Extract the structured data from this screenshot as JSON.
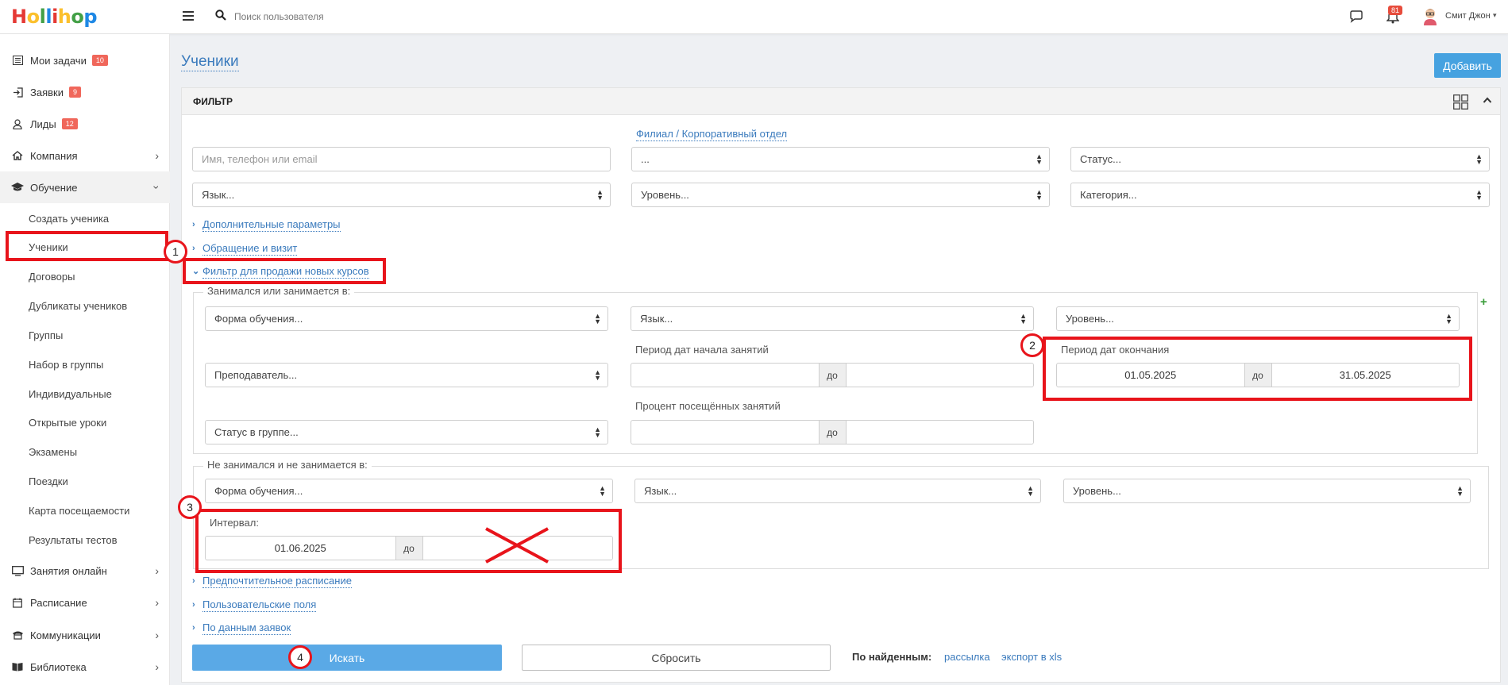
{
  "header": {
    "logo_letters": [
      "H",
      "o",
      "l",
      "l",
      "i",
      "h",
      "o",
      "p"
    ],
    "search_placeholder": "Поиск пользователя",
    "notifications_count": "81",
    "user_name": "Смит Джон"
  },
  "sidebar": {
    "items": [
      {
        "label": "Мои задачи",
        "badge": "10",
        "icon": "list-icon"
      },
      {
        "label": "Заявки",
        "badge": "9",
        "icon": "sign-in-icon"
      },
      {
        "label": "Лиды",
        "badge": "12",
        "icon": "user-icon"
      },
      {
        "label": "Компания",
        "icon": "home-icon"
      },
      {
        "label": "Обучение",
        "icon": "graduation-cap-icon"
      },
      {
        "label": "Занятия онлайн",
        "icon": "monitor-icon"
      },
      {
        "label": "Расписание",
        "icon": "calendar-icon"
      },
      {
        "label": "Коммуникации",
        "icon": "phone-icon"
      },
      {
        "label": "Библиотека",
        "icon": "book-icon"
      }
    ],
    "sub_items": [
      "Создать ученика",
      "Ученики",
      "Договоры",
      "Дубликаты учеников",
      "Группы",
      "Набор в группы",
      "Индивидуальные",
      "Открытые уроки",
      "Экзамены",
      "Поездки",
      "Карта посещаемости",
      "Результаты тестов"
    ]
  },
  "main": {
    "title": "Ученики",
    "add_button": "Добавить",
    "filter_title": "ФИЛЬТР",
    "branch_link": "Филиал / Корпоративный отдел",
    "name_placeholder": "Имя, телефон или email",
    "branch_select": "...",
    "status_select": "Статус...",
    "language_select": "Язык...",
    "level_select": "Уровень...",
    "category_select": "Категория...",
    "links": {
      "extra_params": "Дополнительные параметры",
      "appeal_visit": "Обращение и визит",
      "new_courses_filter": "Фильтр для продажи новых курсов",
      "preferred_schedule": "Предпочтительное расписание",
      "user_fields": "Пользовательские поля",
      "by_requests": "По данным заявок"
    },
    "studied_group": {
      "title": "Занимался или занимается в:",
      "form_select": "Форма обучения...",
      "language_select": "Язык...",
      "level_select": "Уровень...",
      "teacher_select": "Преподаватель...",
      "group_status_select": "Статус в группе...",
      "start_period_label": "Период дат начала занятий",
      "end_period_label": "Период дат окончания",
      "end_from": "01.05.2025",
      "end_to": "31.05.2025",
      "attendance_label": "Процент посещённых занятий",
      "to": "до"
    },
    "not_studied_group": {
      "title": "Не занимался и не занимается в:",
      "form_select": "Форма обучения...",
      "language_select": "Язык...",
      "level_select": "Уровень...",
      "interval_label": "Интервал:",
      "interval_from": "01.06.2025",
      "to": "до"
    },
    "search_button": "Искать",
    "reset_button": "Сбросить",
    "found_label": "По найденным:",
    "mailing_link": "рассылка",
    "export_link": "экспорт в xls"
  },
  "annotations": {
    "markers": [
      "1",
      "2",
      "3",
      "4"
    ],
    "color": "#e8141b"
  }
}
